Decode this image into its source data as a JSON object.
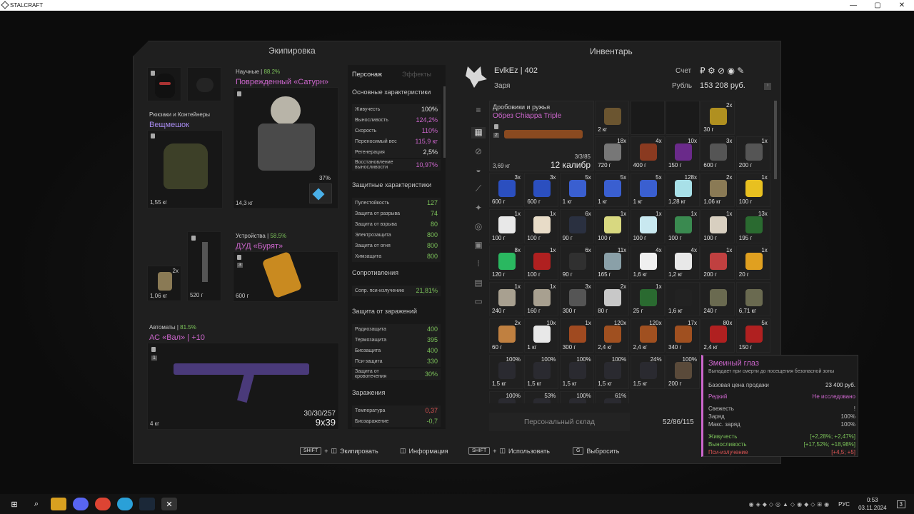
{
  "window": {
    "title": "STALCRAFT",
    "minimize": "—",
    "maximize": "▢",
    "close": "✕"
  },
  "equipment": {
    "header": "Экипировка",
    "armor": {
      "category": "Научные |",
      "percent": "88.2%",
      "name": "Поврежденный «Сатурн»",
      "weight": "14,3 кг",
      "charge": "37%"
    },
    "backpack": {
      "category": "Рюкзаки и Контейнеры",
      "name": "Вещмешок",
      "weight": "1,55 кг"
    },
    "device": {
      "category": "Устройства |",
      "percent": "58.5%",
      "name": "ДУД «Бурят»",
      "weight": "600 г",
      "slot": "3"
    },
    "small1": {
      "qty": "2x",
      "weight": "1,06 кг"
    },
    "small2": {
      "weight": "520 г"
    },
    "weapon": {
      "category": "Автоматы |",
      "percent": "81.5%",
      "name": "АС «Вал»",
      "upgrade": "| +10",
      "slot": "1",
      "weight": "4 кг",
      "ammo": "30/30/257",
      "caliber": "9x39"
    }
  },
  "stats": {
    "tabs": [
      "Персонаж",
      "Эффекты"
    ],
    "basic": {
      "title": "Основные характеристики",
      "rows": [
        {
          "label": "Живучесть",
          "value": "100%",
          "color": "#e0e0e0"
        },
        {
          "label": "Выносливость",
          "value": "124,2%",
          "color": "#cc66cc"
        },
        {
          "label": "Скорость",
          "value": "110%",
          "color": "#cc66cc"
        },
        {
          "label": "Переносимый вес",
          "value": "115,9 кг",
          "color": "#cc66cc"
        },
        {
          "label": "Регенерация",
          "value": "2,5%",
          "color": "#e0e0e0"
        },
        {
          "label": "Восстановление выносливости",
          "value": "10,97%",
          "color": "#cc66cc"
        }
      ]
    },
    "protection": {
      "title": "Защитные характеристики",
      "rows": [
        {
          "label": "Пулестойкость",
          "value": "127",
          "color": "#7cc35a"
        },
        {
          "label": "Защита от разрыва",
          "value": "74",
          "color": "#7cc35a"
        },
        {
          "label": "Защита от взрыва",
          "value": "80",
          "color": "#7cc35a"
        },
        {
          "label": "Электрозащита",
          "value": "800",
          "color": "#7cc35a"
        },
        {
          "label": "Защита от огня",
          "value": "800",
          "color": "#7cc35a"
        },
        {
          "label": "Химзащита",
          "value": "800",
          "color": "#7cc35a"
        }
      ]
    },
    "resist": {
      "title": "Сопротивления",
      "rows": [
        {
          "label": "Сопр. пси-излучению",
          "value": "21,81%",
          "color": "#7cc35a"
        }
      ]
    },
    "infection": {
      "title": "Защита от заражений",
      "rows": [
        {
          "label": "Радиозащита",
          "value": "400",
          "color": "#7cc35a"
        },
        {
          "label": "Термозащита",
          "value": "395",
          "color": "#7cc35a"
        },
        {
          "label": "Биозащита",
          "value": "400",
          "color": "#7cc35a"
        },
        {
          "label": "Пси-защита",
          "value": "330",
          "color": "#7cc35a"
        },
        {
          "label": "Защита от кровотечения",
          "value": "30%",
          "color": "#7cc35a"
        }
      ]
    },
    "contam": {
      "title": "Заражения",
      "rows": [
        {
          "label": "Температура",
          "value": "0,37",
          "color": "#e05555"
        },
        {
          "label": "Биозаражение",
          "value": "-0,7",
          "color": "#7cc35a"
        }
      ]
    }
  },
  "inventory": {
    "header": "Инвентарь",
    "player": "EvlkEz",
    "level": "| 402",
    "faction": "Заря",
    "account_label": "Счет",
    "ruble_label": "Рубль",
    "balance": "153 208 руб.",
    "featured": {
      "category": "Дробовики и ружья",
      "name": "Обрез Chiappa Triple",
      "slot": "2",
      "weight": "3,69 кг",
      "ammo": "3/3/85",
      "caliber": "12 калибр"
    },
    "rows": [
      [
        {
          "w": "2 кг",
          "q": "",
          "c": "#6b5530"
        },
        {
          "w": "",
          "q": "",
          "c": ""
        },
        {
          "w": "",
          "q": "",
          "c": ""
        },
        {
          "w": "30 г",
          "q": "2x",
          "c": "#b09020"
        }
      ],
      [
        {
          "w": "720 г",
          "q": "18x",
          "c": "#777"
        },
        {
          "w": "400 г",
          "q": "4x",
          "c": "#8a3a20"
        },
        {
          "w": "150 г",
          "q": "10x",
          "c": "#6a2a8a"
        },
        {
          "w": "600 г",
          "q": "3x",
          "c": "#555"
        },
        {
          "w": "200 г",
          "q": "1x",
          "c": "#555"
        }
      ],
      [
        {
          "w": "600 г",
          "q": "3x",
          "c": "#2b4fbf"
        },
        {
          "w": "600 г",
          "q": "3x",
          "c": "#2b4fbf"
        },
        {
          "w": "1 кг",
          "q": "5x",
          "c": "#3a5fd0"
        },
        {
          "w": "1 кг",
          "q": "5x",
          "c": "#3a5fd0"
        },
        {
          "w": "1 кг",
          "q": "5x",
          "c": "#3a5fd0"
        },
        {
          "w": "1,28 кг",
          "q": "128x",
          "c": "#a8e0e8"
        },
        {
          "w": "1,06 кг",
          "q": "2x",
          "c": "#8a7a55"
        },
        {
          "w": "100 г",
          "q": "1x",
          "c": "#e8c020"
        }
      ],
      [
        {
          "w": "100 г",
          "q": "1x",
          "c": "#e8e8e8"
        },
        {
          "w": "100 г",
          "q": "1x",
          "c": "#e8dcc8"
        },
        {
          "w": "90 г",
          "q": "6x",
          "c": "#2a3040"
        },
        {
          "w": "100 г",
          "q": "1x",
          "c": "#d8d880"
        },
        {
          "w": "100 г",
          "q": "1x",
          "c": "#c8e8f0"
        },
        {
          "w": "100 г",
          "q": "1x",
          "c": "#3a8a50"
        },
        {
          "w": "100 г",
          "q": "1x",
          "c": "#d8cfc0"
        },
        {
          "w": "195 г",
          "q": "13x",
          "c": "#2a6a30"
        }
      ],
      [
        {
          "w": "120 г",
          "q": "8x",
          "c": "#2ab860"
        },
        {
          "w": "100 г",
          "q": "1x",
          "c": "#b02020"
        },
        {
          "w": "90 г",
          "q": "6x",
          "c": "#303030"
        },
        {
          "w": "165 г",
          "q": "11x",
          "c": "#8aa0a8"
        },
        {
          "w": "1,6 кг",
          "q": "4x",
          "c": "#f0f0f0"
        },
        {
          "w": "1,2 кг",
          "q": "4x",
          "c": "#e8e8e8"
        },
        {
          "w": "200 г",
          "q": "1x",
          "c": "#c04040"
        },
        {
          "w": "20 г",
          "q": "1x",
          "c": "#e0a020"
        }
      ],
      [
        {
          "w": "240 г",
          "q": "1x",
          "c": "#a8a090"
        },
        {
          "w": "160 г",
          "q": "1x",
          "c": "#a8a090"
        },
        {
          "w": "300 г",
          "q": "3x",
          "c": "#555"
        },
        {
          "w": "80 г",
          "q": "2x",
          "c": "#c8c8c8"
        },
        {
          "w": "25 г",
          "q": "1x",
          "c": "#2a6a30"
        },
        {
          "w": "1,6 кг",
          "q": "",
          "c": "#222"
        },
        {
          "w": "240 г",
          "q": "",
          "c": "#6a6a50"
        },
        {
          "w": "6,71 кг",
          "q": "",
          "c": "#6a6a50"
        }
      ],
      [
        {
          "w": "60 г",
          "q": "2x",
          "c": "#c08040"
        },
        {
          "w": "1 кг",
          "q": "10x",
          "c": "#e8e8e8"
        },
        {
          "w": "300 г",
          "q": "1x",
          "c": "#a04a20"
        },
        {
          "w": "2,4 кг",
          "q": "120x",
          "c": "#a05020"
        },
        {
          "w": "2,4 кг",
          "q": "120x",
          "c": "#a05020"
        },
        {
          "w": "340 г",
          "q": "17x",
          "c": "#a05020"
        },
        {
          "w": "2,4 кг",
          "q": "80x",
          "c": "#b02020"
        },
        {
          "w": "150 г",
          "q": "5x",
          "c": "#b02020"
        }
      ],
      [
        {
          "w": "1,5 кг",
          "q": "100%",
          "c": "#2a2a30"
        },
        {
          "w": "1,5 кг",
          "q": "100%",
          "c": "#2a2a30"
        },
        {
          "w": "1,5 кг",
          "q": "100%",
          "c": "#2a2a30"
        },
        {
          "w": "1,5 кг",
          "q": "100%",
          "c": "#2a2a30"
        },
        {
          "w": "1,5 кг",
          "q": "24%",
          "c": "#2a2a30"
        },
        {
          "w": "200 г",
          "q": "100%",
          "c": "#5a4a3a"
        }
      ],
      [
        {
          "w": "",
          "q": "100%",
          "c": "#2a2a30"
        },
        {
          "w": "",
          "q": "53%",
          "c": "#2a2a30"
        },
        {
          "w": "",
          "q": "100%",
          "c": "#2a2a30"
        },
        {
          "w": "",
          "q": "61%",
          "c": "#2a2a30"
        }
      ]
    ],
    "storage": "Персональный склад",
    "capacity": "52/86/115"
  },
  "tooltip": {
    "name": "Змеиный глаз",
    "desc": "Выпадает при смерти до посещения безопасной зоны",
    "price_label": "Базовая цена продажи",
    "price": "23 400 руб.",
    "rarity": "Редкий",
    "status": "Не исследовано",
    "fresh_label": "Свежесть",
    "fresh": "!",
    "charge_label": "Заряд",
    "charge": "100%",
    "maxcharge_label": "Макс. заряд",
    "maxcharge": "100%",
    "e1": "Живучесть",
    "e1v": "[+2,28%; +2,47%]",
    "e2": "Выносливость",
    "e2v": "[+17,52%; +18,98%]",
    "e3": "Пси-излучение",
    "e3v": "[+4,5; +5]"
  },
  "hints": {
    "k1": "SHIFT",
    "a1": "Экипировать",
    "a2": "Информация",
    "k3": "SHIFT",
    "a3": "Использовать",
    "k4": "G",
    "a4": "Выбросить"
  },
  "taskbar": {
    "lang": "РУС",
    "time": "0:53",
    "date": "03.11.2024",
    "notif": "3"
  },
  "colors": {
    "green": "#7cc35a",
    "pink": "#cc66cc",
    "purple": "#a88bf0"
  }
}
